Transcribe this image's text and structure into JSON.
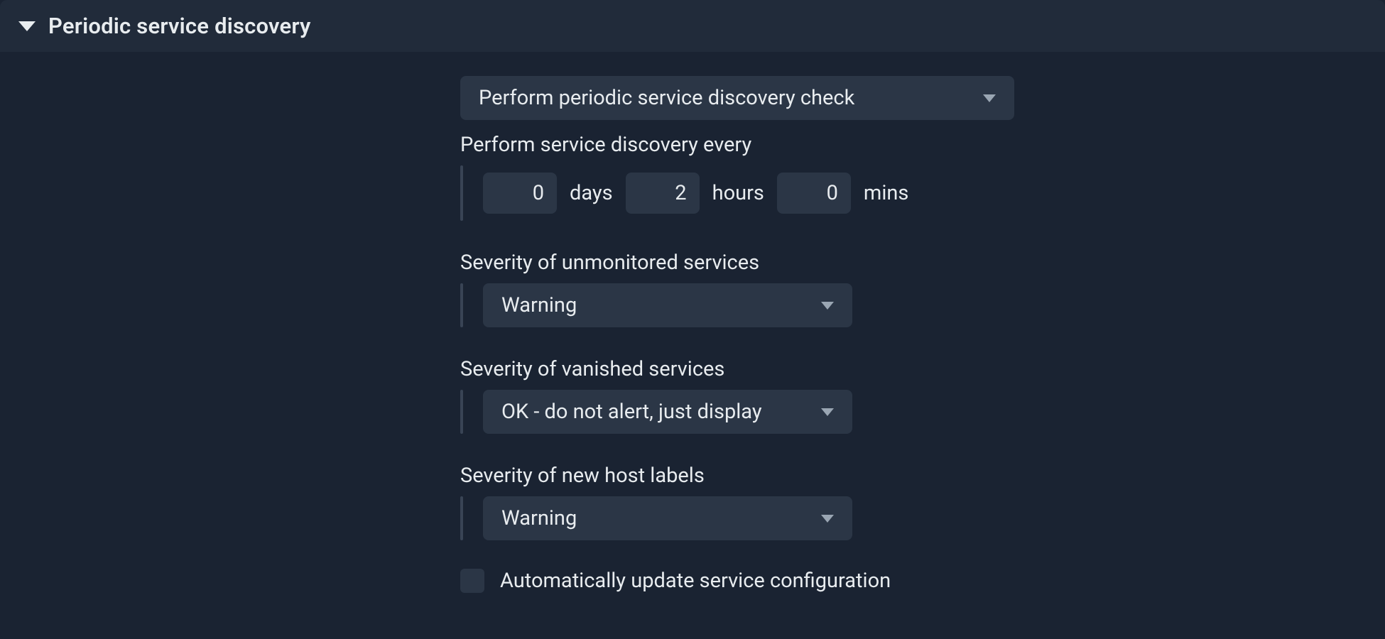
{
  "panel": {
    "title": "Periodic service discovery"
  },
  "mode_select": {
    "value": "Perform periodic service discovery check"
  },
  "interval": {
    "label": "Perform service discovery every",
    "days": "0",
    "days_unit": "days",
    "hours": "2",
    "hours_unit": "hours",
    "mins": "0",
    "mins_unit": "mins"
  },
  "severity_unmonitored": {
    "label": "Severity of unmonitored services",
    "value": "Warning"
  },
  "severity_vanished": {
    "label": "Severity of vanished services",
    "value": "OK - do not alert, just display"
  },
  "severity_new_host_labels": {
    "label": "Severity of new host labels",
    "value": "Warning"
  },
  "auto_update": {
    "label": "Automatically update service configuration",
    "checked": false
  }
}
